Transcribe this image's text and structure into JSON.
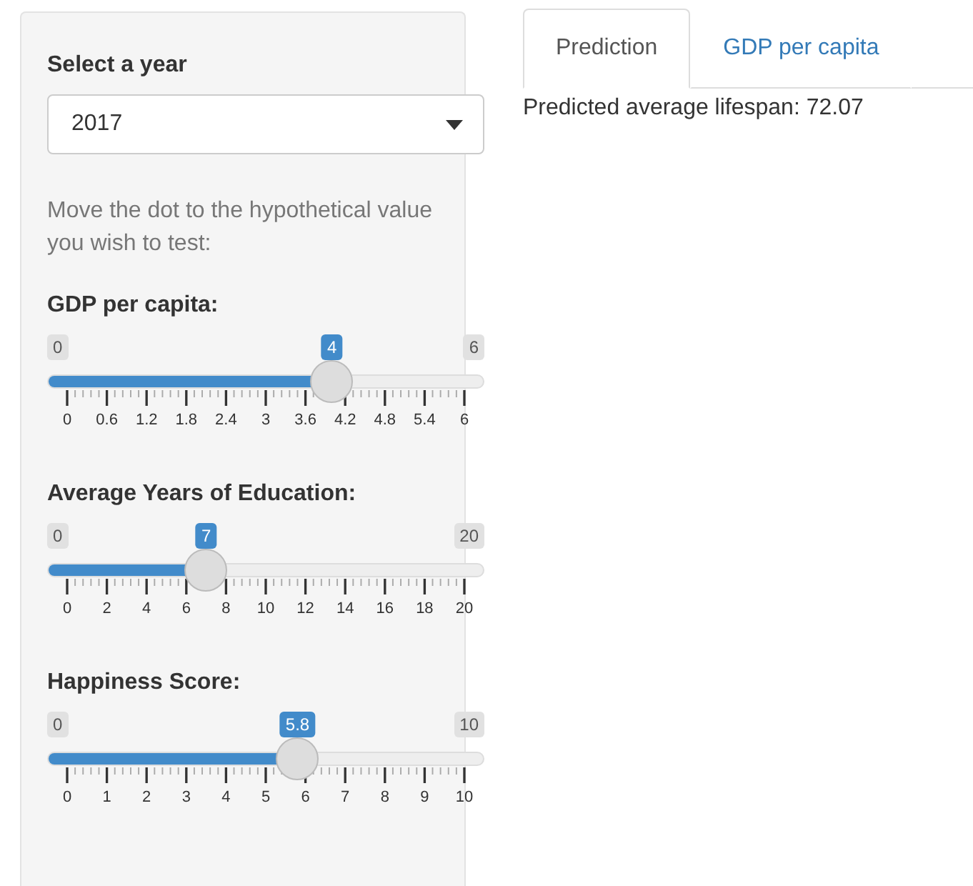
{
  "sidebar": {
    "year_select": {
      "label": "Select a year",
      "value": "2017"
    },
    "instructions": "Move the dot to the hypothetical value you wish to test:",
    "sliders": [
      {
        "label": "GDP per capita:",
        "min": "0",
        "max": "6",
        "value": "4",
        "level": 0.6667,
        "ticks": [
          "0",
          "0.6",
          "1.2",
          "1.8",
          "2.4",
          "3",
          "3.6",
          "4.2",
          "4.8",
          "5.4",
          "6"
        ]
      },
      {
        "label": "Average Years of Education:",
        "min": "0",
        "max": "20",
        "value": "7",
        "level": 0.35,
        "ticks": [
          "0",
          "2",
          "4",
          "6",
          "8",
          "10",
          "12",
          "14",
          "16",
          "18",
          "20"
        ]
      },
      {
        "label": "Happiness Score:",
        "min": "0",
        "max": "10",
        "value": "5.8",
        "level": 0.58,
        "ticks": [
          "0",
          "1",
          "2",
          "3",
          "4",
          "5",
          "6",
          "7",
          "8",
          "9",
          "10"
        ]
      }
    ]
  },
  "tabs": [
    {
      "label": "Prediction",
      "selected": true
    },
    {
      "label": "GDP per capita",
      "selected": false
    }
  ],
  "output": "Predicted average lifespan: 72.07"
}
